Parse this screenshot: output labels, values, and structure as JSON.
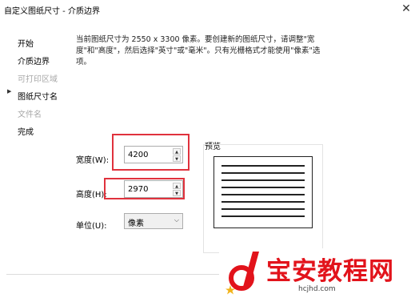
{
  "window": {
    "title": "自定义图纸尺寸 - 介质边界",
    "close_glyph": "✕"
  },
  "nav": {
    "arrow": "▶",
    "items": [
      {
        "label": "开始",
        "state": "normal"
      },
      {
        "label": "介质边界",
        "state": "current"
      },
      {
        "label": "可打印区域",
        "state": "disabled"
      },
      {
        "label": "图纸尺寸名",
        "state": "normal"
      },
      {
        "label": "文件名",
        "state": "disabled"
      },
      {
        "label": "完成",
        "state": "normal"
      }
    ]
  },
  "description": "当前图纸尺寸为 2550 x 3300 像素。要创建新的图纸尺寸，请调整\"宽度\"和\"高度\"，然后选择\"英寸\"或\"毫米\"。只有光栅格式才能使用\"像素\"选项。",
  "form": {
    "width_label": "宽度(W):",
    "width_value": "4200",
    "height_label": "高度(H):",
    "height_value": "2970",
    "units_label": "单位(U):",
    "units_value": "像素",
    "spin_up_glyph": "▲",
    "spin_down_glyph": "▼",
    "chevron_glyph": "⌵"
  },
  "preview": {
    "label": "预览"
  },
  "colors": {
    "highlight_box": "#e0323d",
    "watermark_red": "#e2131b"
  },
  "watermark": {
    "title": "宝安教程网",
    "subtitle": "hcjhd.com"
  }
}
